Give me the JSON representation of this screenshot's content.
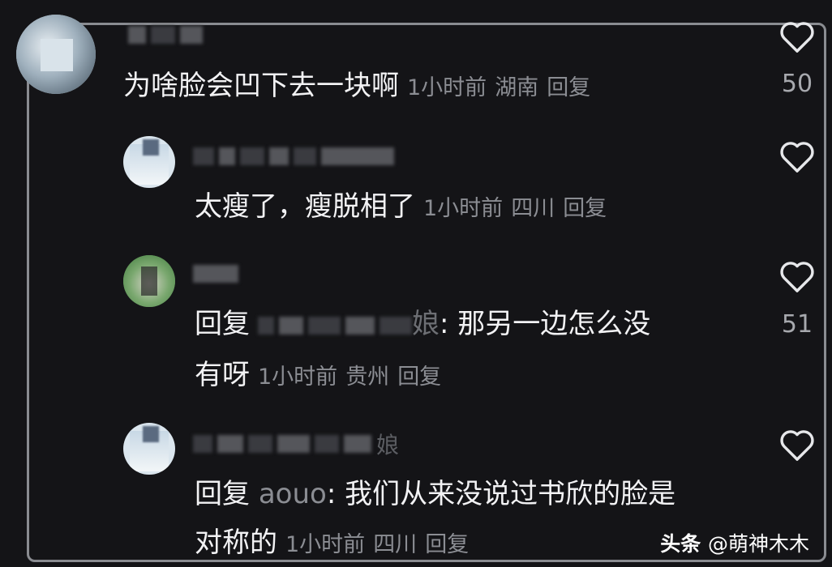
{
  "comments": [
    {
      "text": "为啥脸会凹下去一块啊",
      "time": "1小时前",
      "location": "湖南",
      "reply_label": "回复",
      "likes": "50"
    },
    {
      "text": "太瘦了，瘦脱相了",
      "time": "1小时前",
      "location": "四川",
      "reply_label": "回复",
      "likes": ""
    },
    {
      "reply_prefix": "回复",
      "reply_target_suffix": "娘",
      "text_line1": ": 那另一边怎么没",
      "text_line2": "有呀",
      "time": "1小时前",
      "location": "贵州",
      "reply_label": "回复",
      "likes": "51"
    },
    {
      "reply_prefix": "回复",
      "reply_target": "aouo",
      "text_line1": ": 我们从来没说过书欣的脸是",
      "text_line2": "对称的",
      "time": "1小时前",
      "location": "四川",
      "reply_label": "回复",
      "likes": "",
      "name_suffix": "娘"
    }
  ],
  "watermark": {
    "brand": "头条",
    "handle": "@萌神木木"
  },
  "icons": {
    "like": "heart-outline-icon"
  }
}
